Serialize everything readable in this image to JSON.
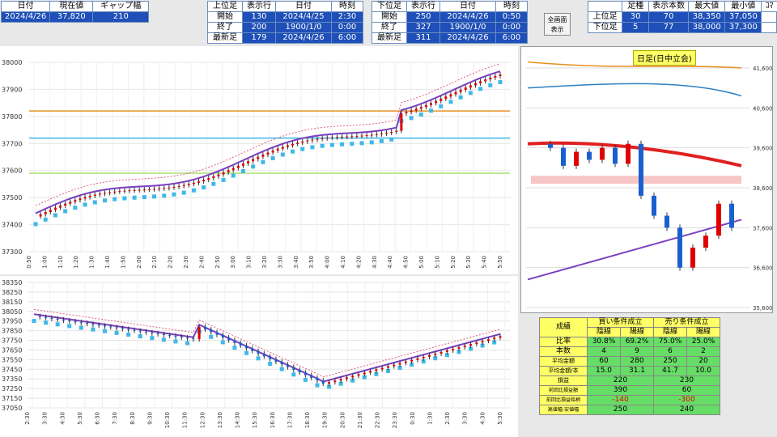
{
  "summary": {
    "headers": [
      "日付",
      "現在値",
      "ギャップ幅"
    ],
    "values": [
      "2024/4/26",
      "37,820",
      "210"
    ]
  },
  "upper": {
    "headers": [
      "上位足",
      "表示行",
      "日付",
      "時刻"
    ],
    "rows": [
      [
        "開始",
        "130",
        "2024/4/25",
        "2:30"
      ],
      [
        "終了",
        "200",
        "1900/1/0",
        "0:00"
      ],
      [
        "最新足",
        "179",
        "2024/4/26",
        "6:00"
      ]
    ]
  },
  "lower": {
    "headers": [
      "下位足",
      "表示行",
      "日付",
      "時刻"
    ],
    "rows": [
      [
        "開始",
        "250",
        "2024/4/26",
        "0:50"
      ],
      [
        "終了",
        "327",
        "1900/1/0",
        "0:00"
      ],
      [
        "最新足",
        "311",
        "2024/4/26",
        "6:00"
      ]
    ]
  },
  "full_button": {
    "line1": "全画面",
    "line2": "表示"
  },
  "tf": {
    "headers": [
      "足種",
      "表示本数",
      "最大値",
      "最小値"
    ],
    "rows": [
      [
        "上位足",
        "30",
        "70",
        "38,350",
        "37,050"
      ],
      [
        "下位足",
        "5",
        "77",
        "38,000",
        "37,300"
      ]
    ],
    "cut": "ｺﾏ"
  },
  "mini_title": "日足(日中立会)",
  "stats": {
    "title": "成績",
    "buy": "買い条件成立",
    "sell": "売り条件成立",
    "cols": [
      "陰線",
      "陽線",
      "陰線",
      "陽線"
    ],
    "rows": [
      [
        "比率",
        "30.8%",
        "69.2%",
        "75.0%",
        "25.0%"
      ],
      [
        "本数",
        "4",
        "9",
        "6",
        "2"
      ],
      [
        "平均金額",
        "60",
        "280",
        "250",
        "20"
      ],
      [
        "平均金額/本",
        "15.0",
        "31.1",
        "41.7",
        "10.0"
      ]
    ],
    "rows2": [
      [
        "損益",
        "220",
        "230"
      ],
      [
        "前回比損益額",
        "390",
        "60"
      ],
      [
        "前回比損益銘柄",
        "-140",
        "-300"
      ],
      [
        "高値幅-安値幅",
        "250",
        "240"
      ]
    ]
  },
  "colors": {
    "bull": "#e00000",
    "bear": "#1a5fd0",
    "accent": "#1f4fb8",
    "panel_bg": "#ffffff",
    "ma_purple": "#7a3fbf",
    "orange": "#e69020",
    "green": "#a8e070",
    "cyan": "#3fb8e8"
  },
  "chart_data": [
    {
      "type": "candlestick",
      "ylim": [
        37300,
        38000
      ],
      "yticks": [
        "38000",
        "37900",
        "37800",
        "37700",
        "37600",
        "37500",
        "37400",
        "37300"
      ],
      "xticks": [
        "0:50",
        "1:00",
        "1:10",
        "1:20",
        "1:30",
        "1:40",
        "1:50",
        "2:00",
        "2:10",
        "2:20",
        "2:30",
        "2:40",
        "2:50",
        "3:00",
        "3:10",
        "3:20",
        "3:30",
        "3:40",
        "3:50",
        "4:00",
        "4:10",
        "4:20",
        "4:30",
        "4:40",
        "4:50",
        "5:00",
        "5:10",
        "5:20",
        "5:30",
        "5:40",
        "5:50"
      ],
      "hlines": [
        {
          "value": 37820,
          "color": "orange"
        },
        {
          "value": 37720,
          "color": "cyan"
        },
        {
          "value": 37590,
          "color": "green"
        }
      ]
    },
    {
      "type": "candlestick",
      "ylim": [
        37050,
        38350
      ],
      "yticks": [
        "38350",
        "38250",
        "38150",
        "38050",
        "37950",
        "37850",
        "37750",
        "37650",
        "37550",
        "37450",
        "37350",
        "37250",
        "37150",
        "37050"
      ],
      "xticks": [
        "2:30",
        "3:30",
        "4:30",
        "5:30",
        "6:30",
        "7:30",
        "8:30",
        "9:30",
        "10:30",
        "11:30",
        "12:30",
        "13:30",
        "14:30",
        "15:30",
        "16:30",
        "17:30",
        "18:30",
        "19:30",
        "20:30",
        "21:30",
        "22:30",
        "23:30",
        "0:30",
        "1:30",
        "2:30",
        "3:30",
        "4:30",
        "5:30"
      ]
    },
    {
      "type": "candlestick",
      "ylim": [
        35600,
        41600
      ],
      "yticks": [
        "41,600",
        "40,600",
        "39,600",
        "38,600",
        "37,600",
        "36,600",
        "35,600"
      ]
    }
  ]
}
